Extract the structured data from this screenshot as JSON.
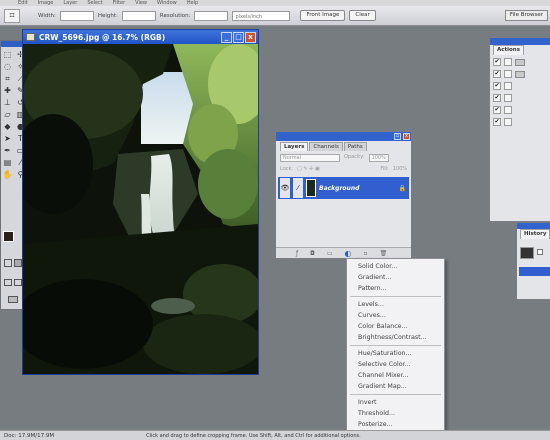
{
  "menubar": {
    "items": [
      "Edit",
      "Image",
      "Layer",
      "Select",
      "Filter",
      "View",
      "Window",
      "Help"
    ]
  },
  "options": {
    "width_label": "Width:",
    "height_label": "Height:",
    "resolution_label": "Resolution:",
    "units_value": "pixels/inch",
    "front_image_label": "Front Image",
    "clear_label": "Clear",
    "file_browser_label": "File Browser"
  },
  "document": {
    "title": "CRW_5696.jpg @ 16.7% (RGB)",
    "minimize": "_",
    "maximize": "□",
    "close": "x"
  },
  "layers_panel": {
    "tabs": [
      "Layers",
      "Channels",
      "Paths"
    ],
    "blend_mode": "Normal",
    "opacity_label": "Opacity:",
    "opacity_value": "100%",
    "lock_label": "Lock:",
    "fill_label": "Fill:",
    "fill_value": "100%",
    "layer_name": "Background"
  },
  "adjust_menu": {
    "group1": [
      "Solid Color...",
      "Gradient...",
      "Pattern..."
    ],
    "group2": [
      "Levels...",
      "Curves...",
      "Color Balance...",
      "Brightness/Contrast..."
    ],
    "group3": [
      "Hue/Saturation...",
      "Selective Color...",
      "Channel Mixer...",
      "Gradient Map..."
    ],
    "group4": [
      "Invert",
      "Threshold...",
      "Posterize..."
    ]
  },
  "actions_panel": {
    "tab": "Actions",
    "checks": [
      "✔",
      "✔",
      "✔",
      "✔",
      "✔",
      "✔"
    ]
  },
  "history_panel": {
    "tab": "History"
  },
  "status": {
    "doc_size": "Doc: 17.9M/17.9M",
    "hint": "Click and drag to define cropping frame. Use Shift, Alt, and Ctrl for additional options."
  },
  "colors": {
    "titlebar": "#2253c6",
    "workspace": "#777c80",
    "selection": "#315fd0"
  }
}
